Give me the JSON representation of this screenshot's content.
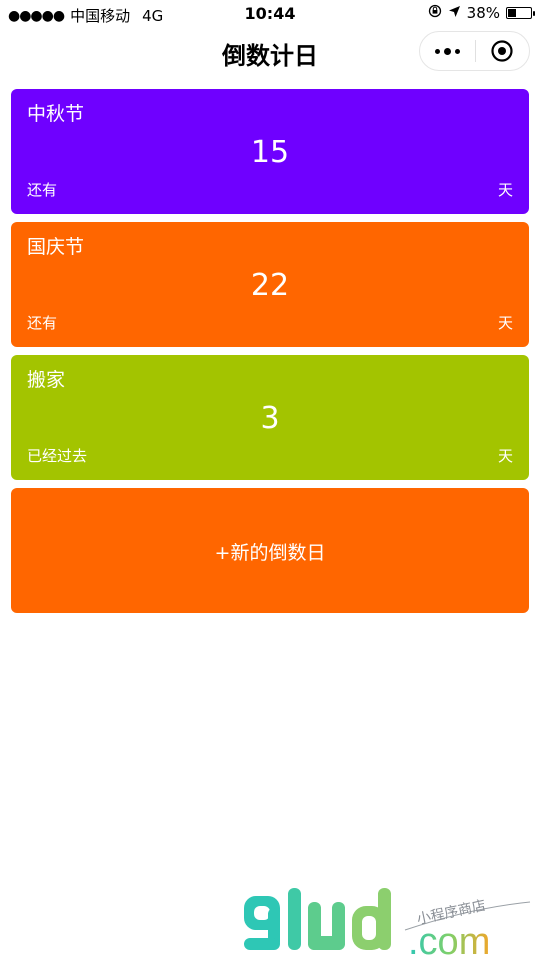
{
  "status": {
    "carrier": "中国移动",
    "network": "4G",
    "time": "10:44",
    "battery_percent": "38%",
    "battery_level": 0.38
  },
  "nav": {
    "title": "倒数计日"
  },
  "cards": [
    {
      "title": "中秋节",
      "count": "15",
      "prefix": "还有",
      "unit": "天",
      "color": "#6f00ff"
    },
    {
      "title": "国庆节",
      "count": "22",
      "prefix": "还有",
      "unit": "天",
      "color": "#ff6600"
    },
    {
      "title": "搬家",
      "count": "3",
      "prefix": "已经过去",
      "unit": "天",
      "color": "#a3c400"
    }
  ],
  "add_card": {
    "label": "+新的倒数日",
    "color": "#ff6600"
  },
  "watermark": {
    "brand": "glud",
    "domain": ".com",
    "tagline": "小程序商店"
  }
}
